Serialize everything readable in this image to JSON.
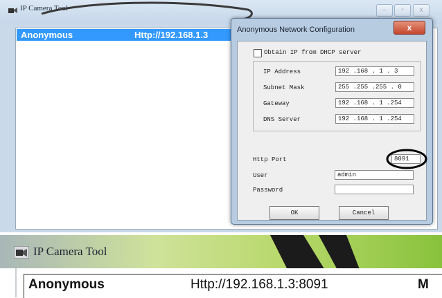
{
  "main_window": {
    "title": "IP Camera Tool",
    "controls": {
      "minimize": "–",
      "maximize": "▫",
      "close": "x"
    },
    "list": {
      "rows": [
        {
          "name": "Anonymous",
          "url": "Http://192.168.1.3"
        }
      ]
    }
  },
  "dialog": {
    "title": "Anonymous Network Configuration",
    "close_glyph": "x",
    "dhcp": {
      "label": "Obtain IP from DHCP server",
      "checked": false
    },
    "ip_address": {
      "label": "IP Address",
      "value": "192 .168 . 1 . 3"
    },
    "subnet_mask": {
      "label": "Subnet Mask",
      "value": "255 .255 .255 . 0"
    },
    "gateway": {
      "label": "Gateway",
      "value": "192 .168 . 1 .254"
    },
    "dns_server": {
      "label": "DNS Server",
      "value": "192 .168 . 1 .254"
    },
    "http_port": {
      "label": "Http Port",
      "value": "8091"
    },
    "user": {
      "label": "User",
      "value": "admin"
    },
    "password": {
      "label": "Password",
      "value": ""
    },
    "ok_label": "OK",
    "cancel_label": "Cancel",
    "annotation_color": "#000000"
  },
  "zoomed_window": {
    "title": "IP Camera Tool",
    "row": {
      "name": "Anonymous",
      "url": "Http://192.168.1.3:8091",
      "extra": "M"
    }
  },
  "colors": {
    "selection": "#3399ff",
    "close_button": "#c4452c"
  }
}
